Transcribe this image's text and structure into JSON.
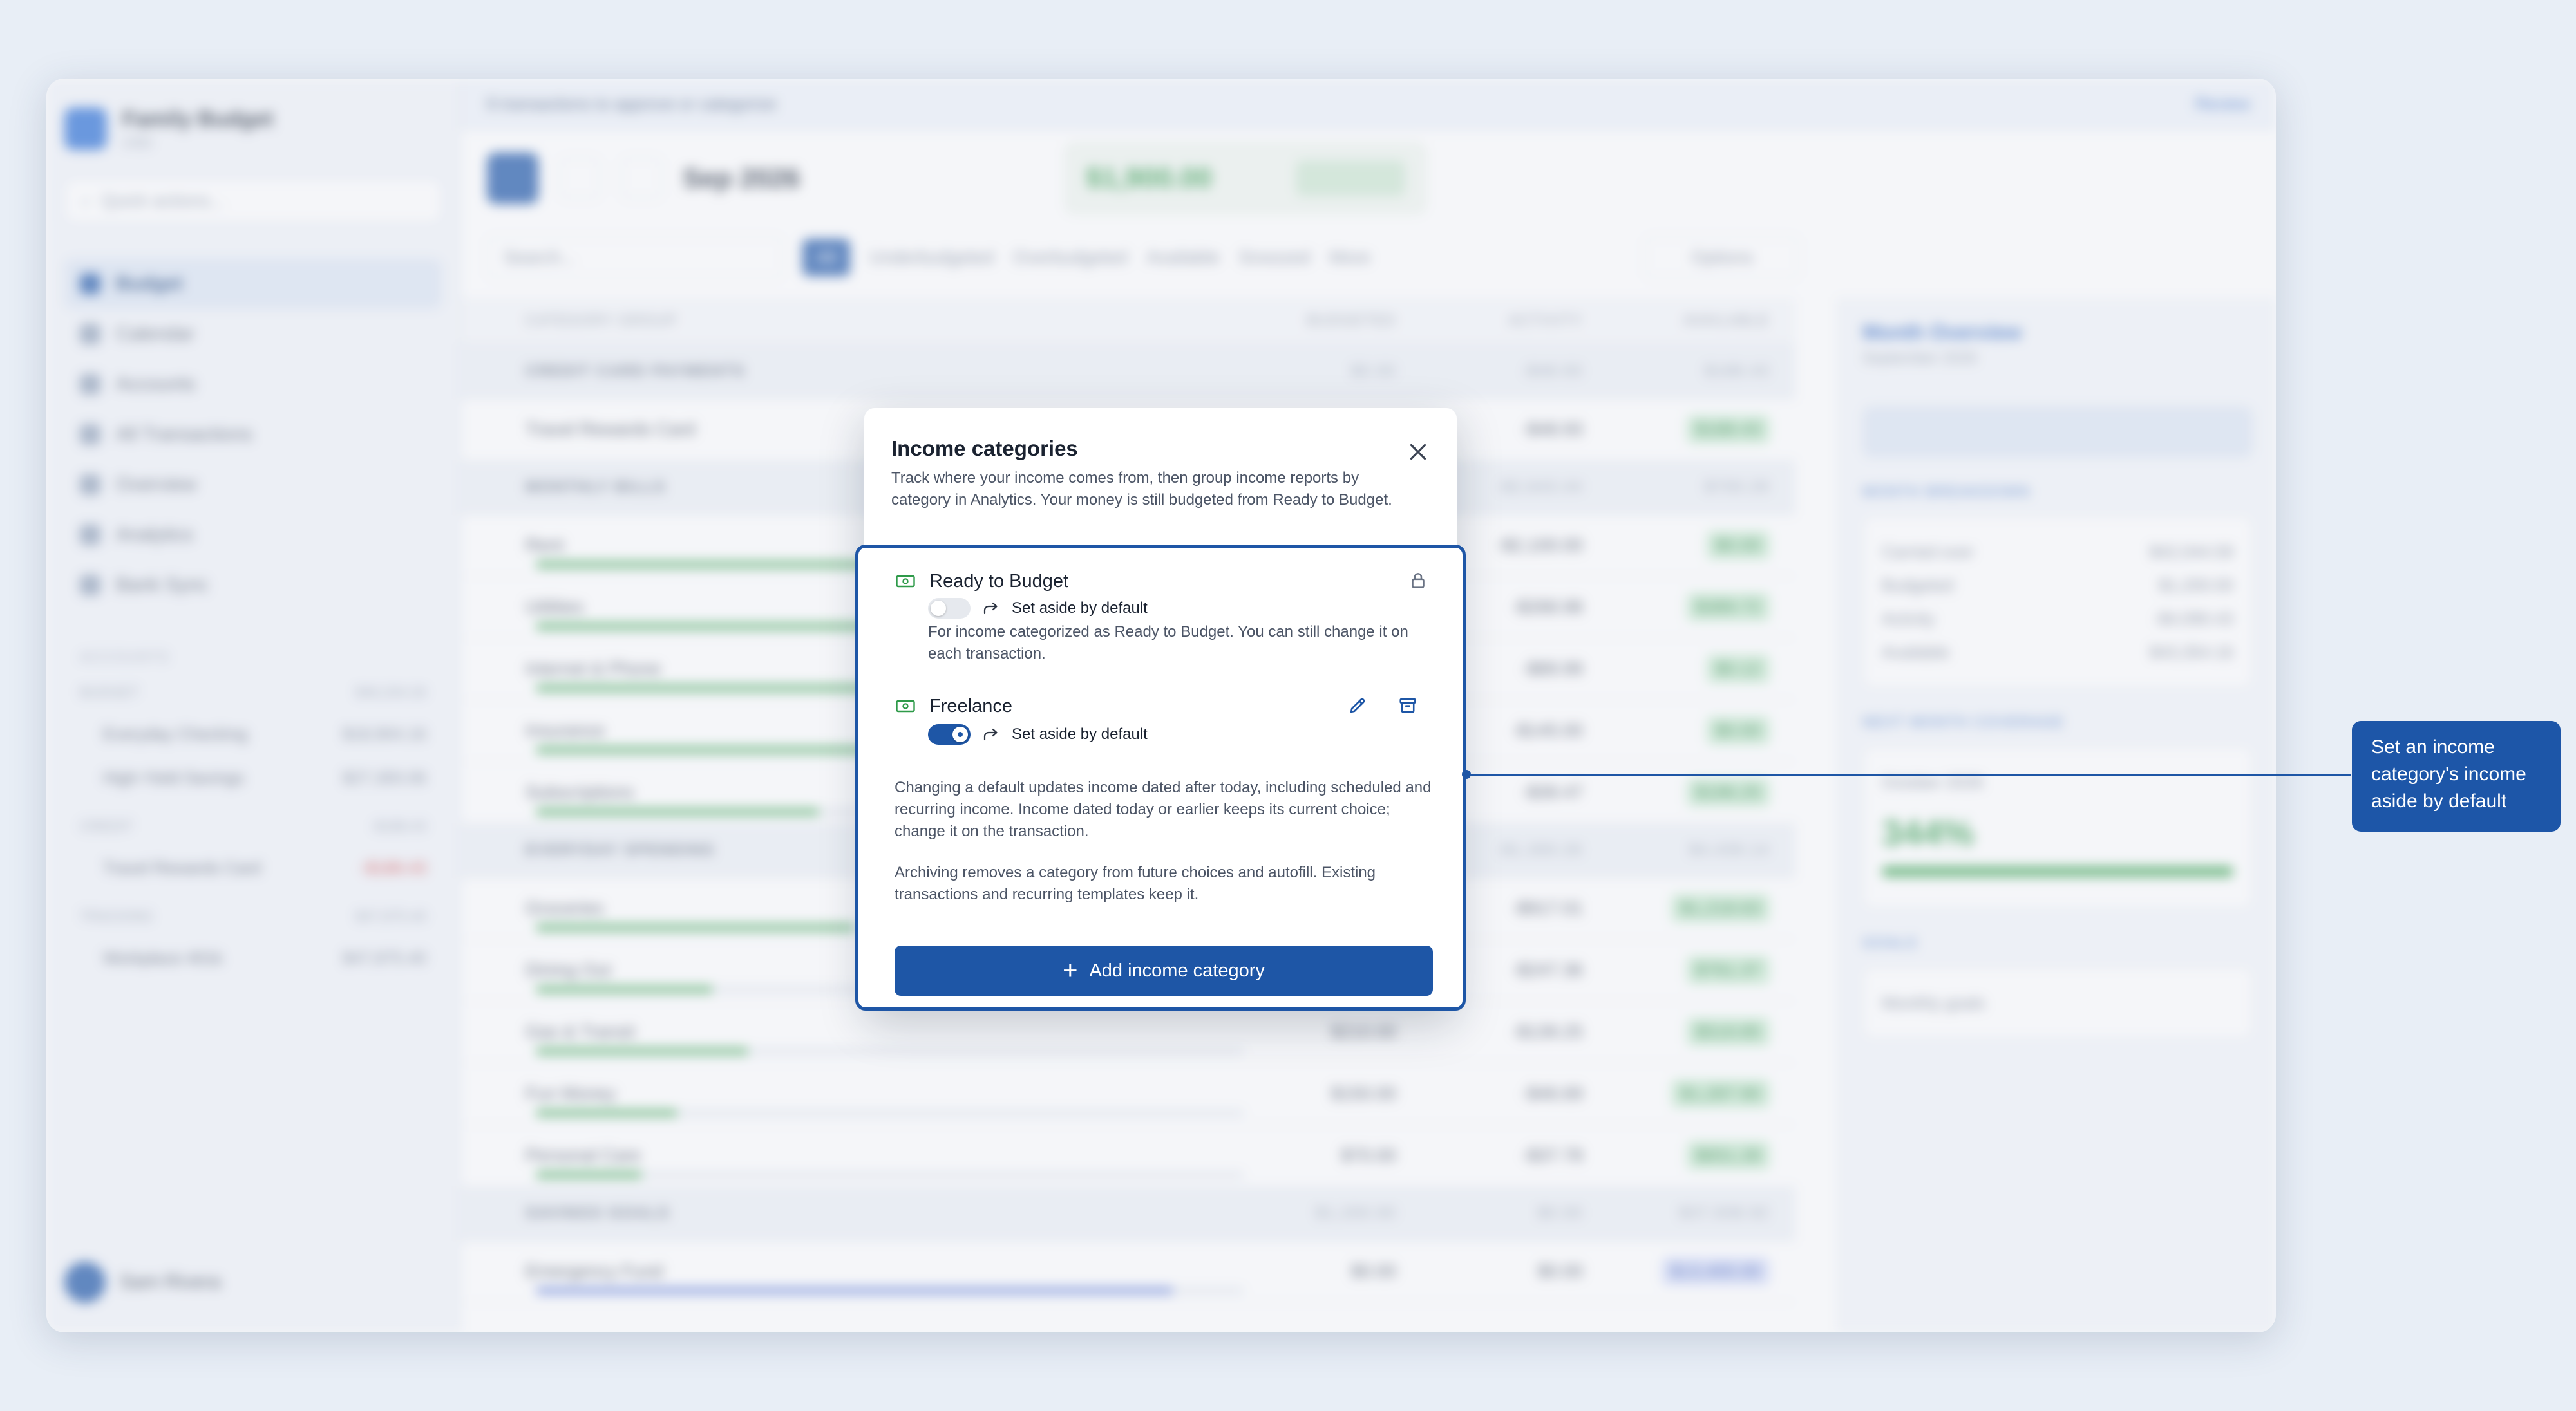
{
  "background": {
    "workspace_name": "Family Budget",
    "workspace_currency": "USD",
    "quick_actions_placeholder": "Quick actions...",
    "nav": [
      "Budget",
      "Calendar",
      "Accounts",
      "All Transactions",
      "Overview",
      "Analytics",
      "Bank Sync"
    ],
    "accounts_heading": "ACCOUNTS",
    "account_groups": [
      {
        "name": "BUDGET",
        "amount": "$46,204.26",
        "accounts": [
          {
            "name": "Everyday Checking",
            "amount": "$18,904.16"
          },
          {
            "name": "High-Yield Savings",
            "amount": "$27,300.06"
          }
        ]
      },
      {
        "name": "CREDIT",
        "amount": "-$188.43",
        "accounts": [
          {
            "name": "Travel Rewards Card",
            "amount": "-$188.43"
          }
        ]
      },
      {
        "name": "TRACKING",
        "amount": "$47,875.40",
        "accounts": [
          {
            "name": "Workplace 401k",
            "amount": "$47,875.40"
          }
        ]
      }
    ],
    "user_name": "Sam Rivera",
    "banner_text": "6 transactions to approve or categorize",
    "banner_action": "Review",
    "month": "Sep 2026",
    "ready_to_budget_amount": "$1,900.00",
    "ready_to_budget_label": "Budget",
    "search_placeholder": "Search...",
    "filters": [
      "All",
      "Underbudgeted",
      "Overbudgeted",
      "Available",
      "Snoozed",
      "More"
    ],
    "options_label": "Options",
    "columns": [
      "CATEGORY GROUP",
      "BUDGETED",
      "ACTIVITY",
      "AVAILABLE"
    ],
    "groups": [
      {
        "name": "CREDIT CARD PAYMENTS",
        "budgeted": "$0.00",
        "activity": "-$48.93",
        "available": "$188.43",
        "rows": [
          {
            "name": "Travel Rewards Card",
            "budgeted": "",
            "activity": "-$48.93",
            "available": "$188.43",
            "progress": 0
          }
        ]
      },
      {
        "name": "MONTHLY BILLS",
        "budgeted": "",
        "activity": "-$2,643.44",
        "available": "$700.29",
        "rows": [
          {
            "name": "Rent",
            "budgeted": "",
            "activity": "-$2,100.00",
            "available": "$0.00",
            "progress": 1
          },
          {
            "name": "Utilities",
            "budgeted": "",
            "activity": "-$268.98",
            "available": "$389.72",
            "progress": 0.6
          },
          {
            "name": "Internet & Phone",
            "budgeted": "",
            "activity": "-$89.99",
            "available": "$0.12",
            "progress": 1
          },
          {
            "name": "Insurance",
            "budgeted": "",
            "activity": "-$145.00",
            "available": "$0.00",
            "progress": 1
          },
          {
            "name": "Subscriptions",
            "budgeted": "",
            "activity": "-$39.47",
            "available": "$196.25",
            "progress": 0.4
          }
        ]
      },
      {
        "name": "EVERYDAY SPENDING",
        "budgeted": "",
        "activity": "-$1,300.26",
        "available": "$4,439.14",
        "rows": [
          {
            "name": "Groceries",
            "budgeted": "",
            "activity": "-$917.01",
            "available": "$1,218.63",
            "progress": 0.45
          },
          {
            "name": "Dining Out",
            "budgeted": "",
            "activity": "-$247.36",
            "available": "$761.37",
            "progress": 0.25
          },
          {
            "name": "Gas & Transit",
            "budgeted": "$210.00",
            "activity": "-$139.25",
            "available": "$519.85",
            "progress": 0.3
          },
          {
            "name": "Fun Money",
            "budgeted": "$150.00",
            "activity": "-$46.69",
            "available": "$1,287.90",
            "progress": 0.2
          },
          {
            "name": "Personal Care",
            "budgeted": "$70.00",
            "activity": "-$37.78",
            "available": "$651.28",
            "progress": 0.15
          }
        ]
      },
      {
        "name": "SAVINGS GOALS",
        "budgeted": "$1,200.00",
        "activity": "$0.00",
        "available": "$37,938.92",
        "rows": [
          {
            "name": "Emergency Fund",
            "budgeted": "$0.00",
            "activity": "$0.00",
            "available": "$13,400.00",
            "progress": 0.9
          }
        ]
      }
    ],
    "right_panel": {
      "title": "Month Overview",
      "subtitle": "September 2026",
      "auto_budget": "Auto-budget all categories",
      "breakdown_heading": "MONTH BREAKDOWN",
      "breakdown": [
        {
          "label": "Carried over",
          "value": "$42,044.59"
        },
        {
          "label": "Budgeted",
          "value": "$1,200.00"
        },
        {
          "label": "Activity",
          "value": "-$4,090.43"
        },
        {
          "label": "Available",
          "value": "$43,354.16"
        }
      ],
      "coverage_heading": "NEXT MONTH COVERAGE",
      "coverage_month": "October 2026",
      "coverage_percent": "344%",
      "coverage_progress": 1,
      "goals_heading": "GOALS",
      "goals_title": "Monthly goals"
    }
  },
  "modal": {
    "title": "Income categories",
    "description": "Track where your income comes from, then group income reports by category in Analytics. Your money is still budgeted from Ready to Budget.",
    "categories": [
      {
        "name": "Ready to Budget",
        "set_aside_label": "Set aside by default",
        "set_aside": false,
        "locked": true,
        "note": "For income categorized as Ready to Budget. You can still change it on each transaction."
      },
      {
        "name": "Freelance",
        "set_aside_label": "Set aside by default",
        "set_aside": true,
        "locked": false
      }
    ],
    "info_default": "Changing a default updates income dated after today, including scheduled and recurring income. Income dated today or earlier keeps its current choice; change it on the transaction.",
    "info_archive": "Archiving removes a category from future choices and autofill. Existing transactions and recurring templates keep it.",
    "add_button": "Add income category"
  },
  "callout": {
    "text": "Set an income category's income aside by default"
  },
  "colors": {
    "accent": "#1e56a6",
    "positive": "#2e9a49",
    "negative": "#d13c3c"
  }
}
